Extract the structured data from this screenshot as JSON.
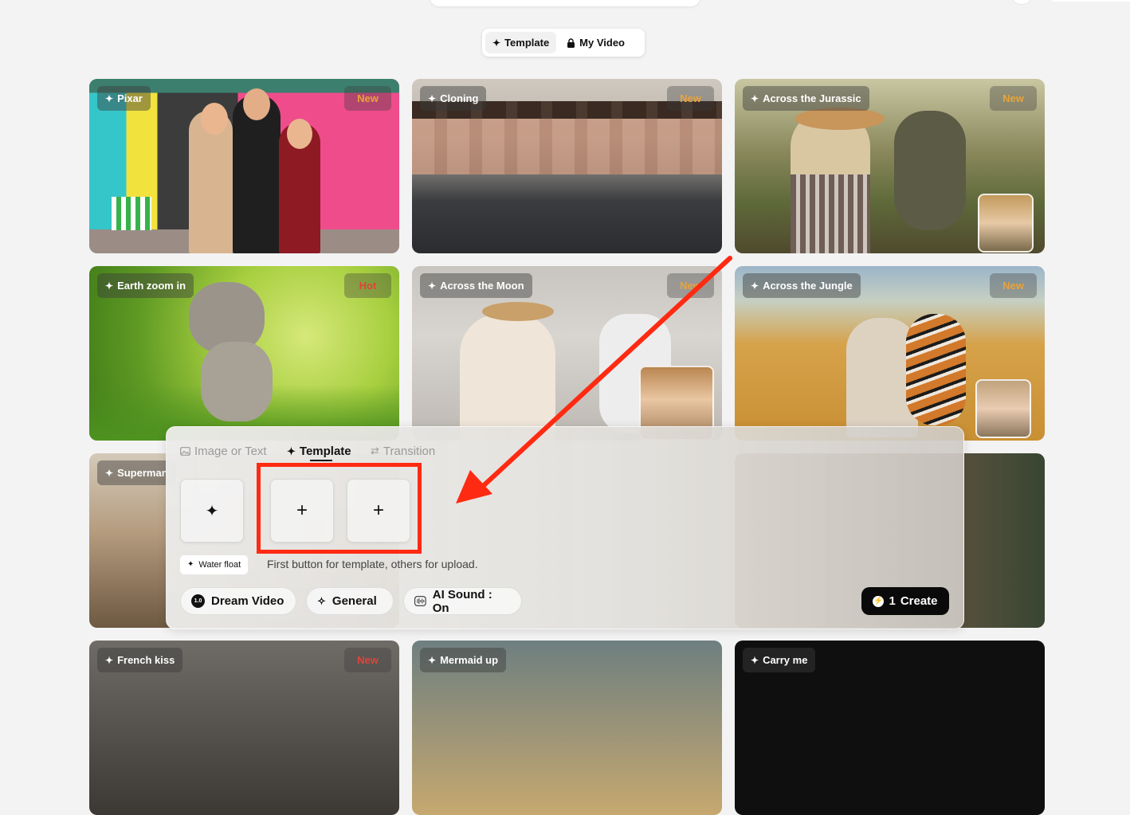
{
  "tabs": [
    {
      "label": "Template",
      "icon": "sparkle-icon",
      "active": true
    },
    {
      "label": "My Video",
      "icon": "lock-icon",
      "active": false
    }
  ],
  "cards": [
    {
      "name": "Pixar",
      "badge": "New",
      "badge_type": "new"
    },
    {
      "name": "Cloning",
      "badge": "New",
      "badge_type": "new"
    },
    {
      "name": "Across the Jurassic",
      "badge": "New",
      "badge_type": "new"
    },
    {
      "name": "Earth zoom in",
      "badge": "Hot",
      "badge_type": "hot"
    },
    {
      "name": "Across the Moon",
      "badge": "New",
      "badge_type": "new"
    },
    {
      "name": "Across the Jungle",
      "badge": "New",
      "badge_type": "new"
    },
    {
      "name": "Superman",
      "badge": "",
      "badge_type": ""
    },
    {
      "name": "French kiss",
      "badge": "New",
      "badge_type": "hot"
    },
    {
      "name": "Mermaid up",
      "badge": "",
      "badge_type": ""
    },
    {
      "name": "Carry me",
      "badge": "",
      "badge_type": ""
    }
  ],
  "panel": {
    "tabs": [
      {
        "label": "Image or Text",
        "icon": "image-icon"
      },
      {
        "label": "Template",
        "icon": "sparkle-icon"
      },
      {
        "label": "Transition",
        "icon": "swap-icon"
      }
    ],
    "template_slot_icon": "sparkle-icon",
    "upload_slot_symbol": "+",
    "chip_label": "Water float",
    "hint": "First button for template, others for upload.",
    "model_label": "Dream Video",
    "model_version": "1.0",
    "style_label": "General",
    "sound_label": "AI Sound : On",
    "create_cost": "1",
    "create_label": "Create"
  },
  "colors": {
    "annotation": "#ff2a12",
    "new_badge": "#e8a33a",
    "hot_badge": "#e0443a"
  }
}
